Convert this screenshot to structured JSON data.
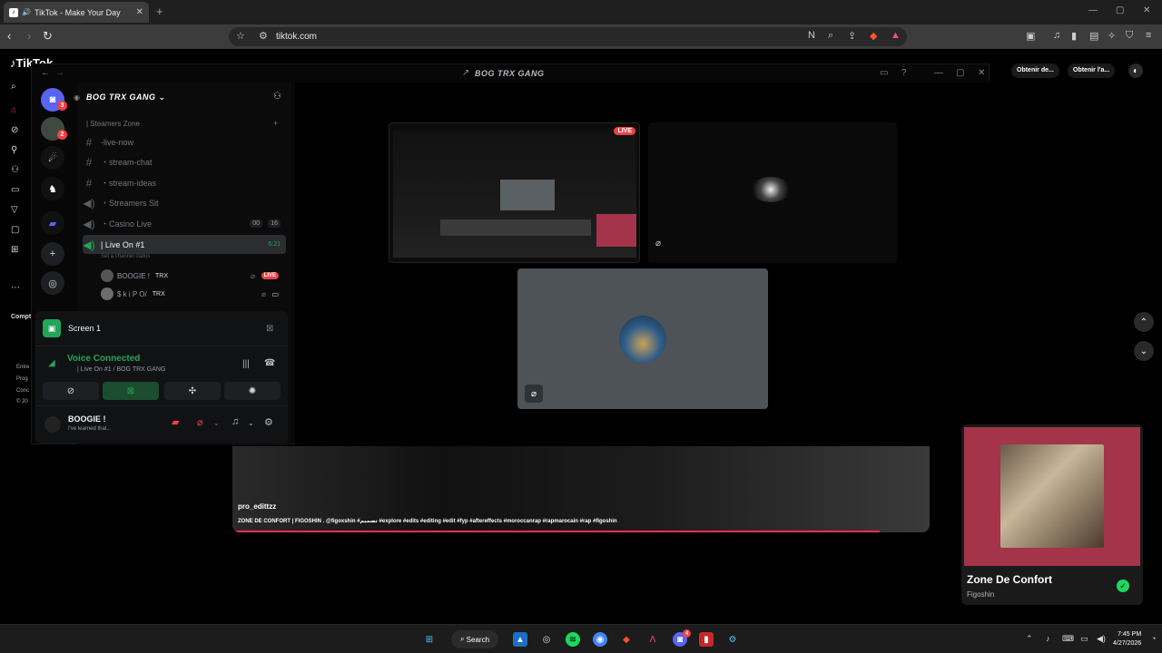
{
  "browser": {
    "tab_title": "TikTok - Make Your Day",
    "tab_close": "✕",
    "new_tab": "+",
    "url": "tiktok.com"
  },
  "tiktok": {
    "buttons": [
      "Obtenir de...",
      "Obtenir l'a..."
    ],
    "left_labels": [
      "Compt",
      "Entre",
      "Prog",
      "Conc",
      "© 20"
    ],
    "video": {
      "username": "pro_edittzz",
      "caption": "ZONE DE CONFORT | FIGOSHIN . @figoxshin #تصميم #explore #edits #editing #edit #fyp #aftereffects #moroccanrap #rapmarocain #rap #figoshin"
    }
  },
  "discord": {
    "window_title": "BOG TRX GANG",
    "server_name": "BOG TRX GANG",
    "guild_badges": [
      "3",
      "2"
    ],
    "category": "| Steamers Zone",
    "channels": [
      {
        "name": "-live-now",
        "type": "text"
      },
      {
        "name": "・stream-chat",
        "type": "text"
      },
      {
        "name": "・stream-ideas",
        "type": "text"
      },
      {
        "name": "・Streamers Sit",
        "type": "voice"
      },
      {
        "name": "・Casino Live",
        "type": "voice",
        "count_a": "00",
        "count_b": "16"
      },
      {
        "name": "| Live On #1",
        "type": "voice",
        "time": "6:21",
        "active": true
      }
    ],
    "channel_status": "Set a channel status",
    "voice_users": [
      {
        "name": "BOOGIE !",
        "tag": "TRX",
        "badge": "LIVE"
      },
      {
        "name": "$ k i P O/",
        "tag": "TRX"
      }
    ],
    "panel": {
      "screen_label": "Screen 1",
      "voice_connected": "Voice Connected",
      "voice_location": "| Live On #1 / BOG TRX GANG",
      "username": "BOOGIE !",
      "user_status": "I've learned that..."
    },
    "stage": {
      "live_badge": "LIVE"
    }
  },
  "spotify": {
    "title": "Zone De Confort",
    "artist": "Figoshin",
    "accent": "#a3344a"
  },
  "taskbar": {
    "search_label": "Search",
    "time": "7:45 PM",
    "date": "4/27/2026",
    "discord_badge": "4"
  }
}
